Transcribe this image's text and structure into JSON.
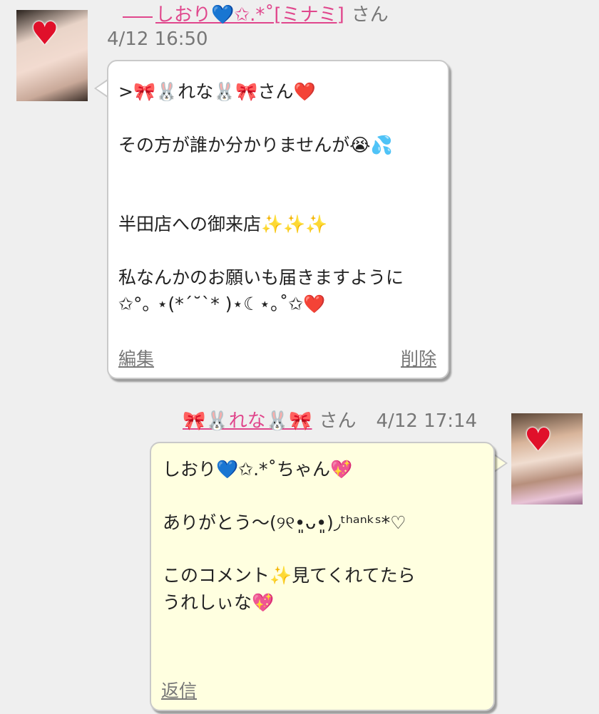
{
  "post1": {
    "author_name": "しおり💙✩.*˚[ミナミ]",
    "author_suffix": "さん",
    "timestamp": "4/12 16:50",
    "lines": [
      ">🎀🐰れな🐰🎀さん❤️",
      "",
      "その方が誰か分かりませんが😭💦",
      "",
      "",
      "半田店への御来店✨✨✨",
      "",
      "私なんかのお願いも届きますように",
      "✩°｡ ⋆(*´˘`* )⋆☾⋆｡˚✩❤️"
    ],
    "edit_label": "編集",
    "delete_label": "削除"
  },
  "post2": {
    "author_name": "🎀🐰れな🐰🎀",
    "author_suffix": "さん",
    "timestamp": "4/12 17:14",
    "lines": [
      "しおり💙✩.*˚ちゃん💖",
      "",
      "ありがとう〜(୨୧•͈ᴗ•͈)◞ᵗʰᵃⁿᵏˢ*♡",
      "",
      "このコメント✨見てくれてたら",
      "うれしぃな💖"
    ],
    "reply_label": "返信"
  },
  "colors": {
    "name_pink": "#e0468c",
    "bubble_yellow": "#ffffe0",
    "background": "#efefef"
  }
}
